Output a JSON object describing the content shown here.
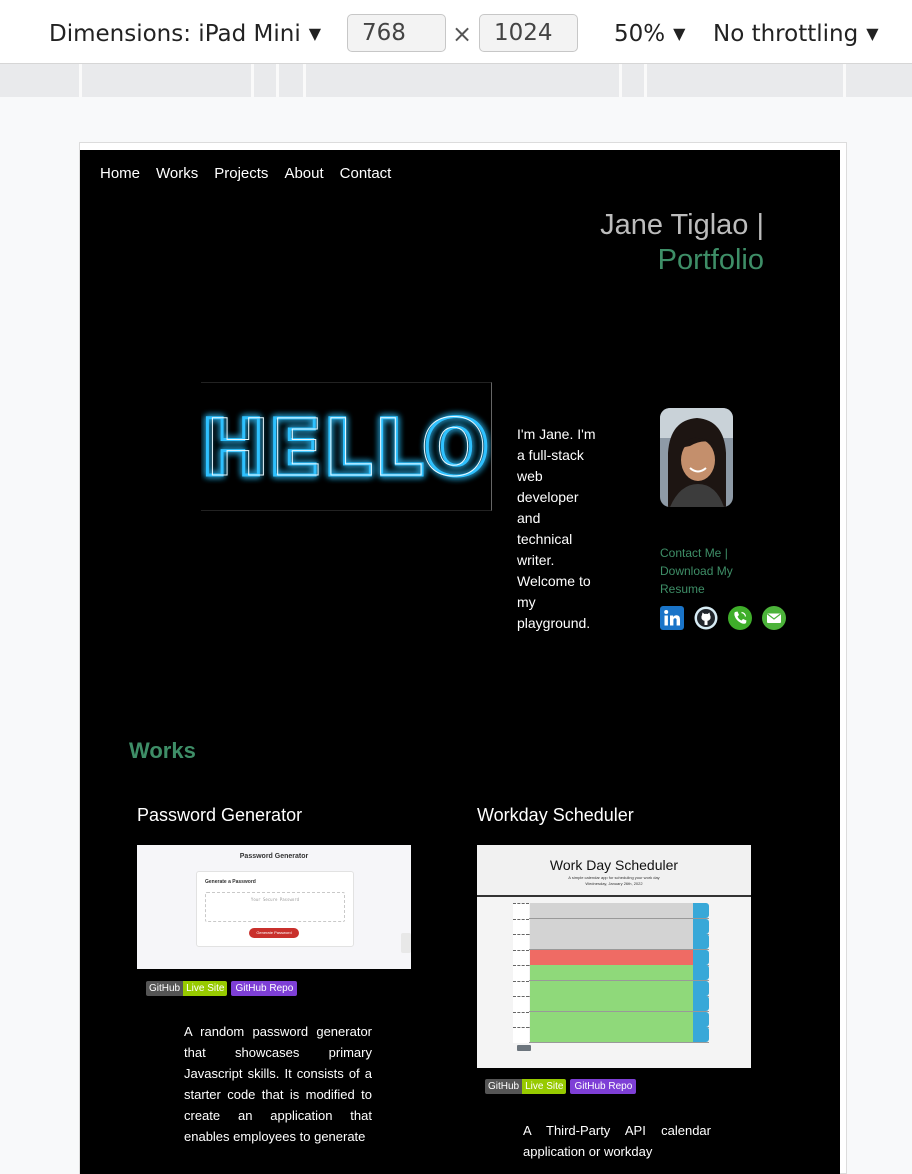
{
  "devtools": {
    "dimensions_label": "Dimensions: iPad Mini",
    "width": "768",
    "height": "1024",
    "zoom": "50%",
    "throttling": "No throttling",
    "caret": "▼",
    "times": "×"
  },
  "site": {
    "nav": [
      "Home",
      "Works",
      "Projects",
      "About",
      "Contact"
    ],
    "brand": {
      "name": "Jane Tiglao |",
      "sub": "Portfolio"
    },
    "hero": {
      "hello_text": "HELLO",
      "intro": "I'm Jane. I'm a full-stack web developer and technical writer. Welcome to my playground.",
      "contact_links": "Contact Me | Download My Resume",
      "social_icons": [
        "linkedin-icon",
        "github-icon",
        "phone-icon",
        "email-icon"
      ]
    },
    "works": {
      "title": "Works",
      "cards": [
        {
          "title": "Password Generator",
          "shot": {
            "heading": "Password Generator",
            "subheading": "Generate a Password",
            "placeholder": "Your Secure Password",
            "button": "Generate Password"
          },
          "badge_left": "GitHub",
          "badge_right": "Live Site",
          "badge_repo": "GitHub Repo",
          "description": "A random password generator that showcases primary Javascript skills. It consists of a starter code that is modified to create an application that enables employees to generate"
        },
        {
          "title": "Workday Scheduler",
          "shot": {
            "heading": "Work Day Scheduler",
            "tagline": "A simple calendar app for scheduling your work day",
            "date": "Wednesday, January 26th, 2022"
          },
          "badge_left": "GitHub",
          "badge_right": "Live Site",
          "badge_repo": "GitHub Repo",
          "description": "A Third-Party API calendar application or workday"
        }
      ]
    }
  },
  "colors": {
    "accent_green": "#3e8e67",
    "neon_blue": "#2fc1ff",
    "past_row": "#d3d3d3",
    "present_row": "#ef6b64",
    "future_row": "#8fd97a",
    "save_blue": "#38a8d8"
  }
}
